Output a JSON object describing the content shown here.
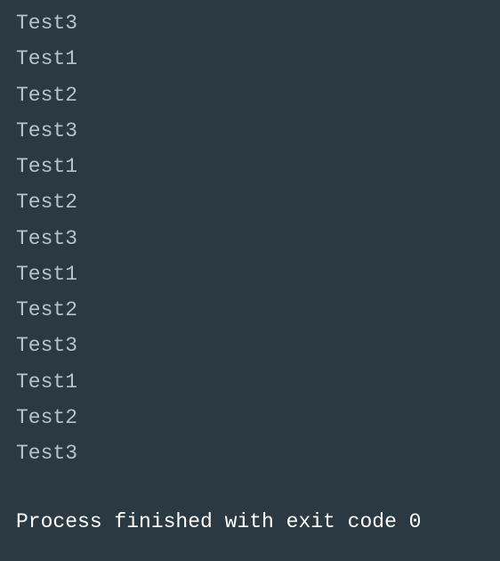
{
  "console": {
    "lines": [
      "Test3",
      "Test1",
      "Test2",
      "Test3",
      "Test1",
      "Test2",
      "Test3",
      "Test1",
      "Test2",
      "Test3",
      "Test1",
      "Test2",
      "Test3"
    ],
    "status": "Process finished with exit code 0"
  }
}
